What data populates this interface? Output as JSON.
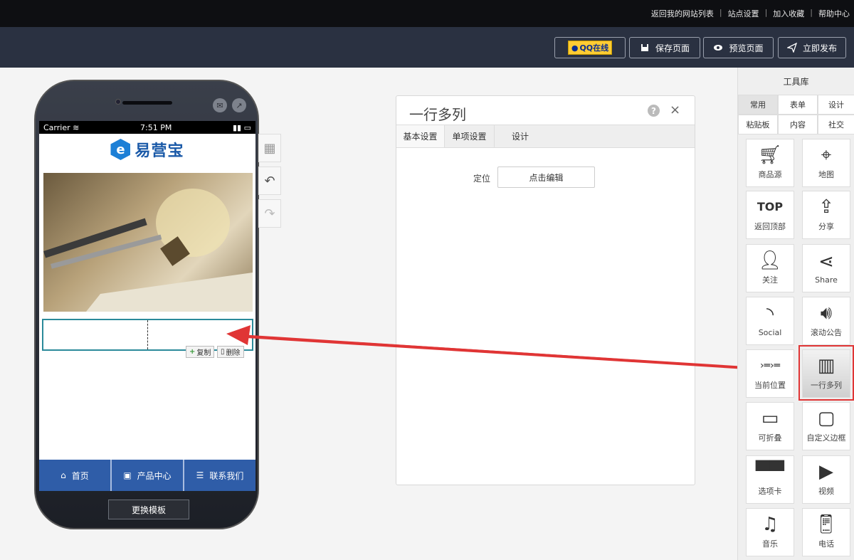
{
  "topbar": {
    "links": [
      "返回我的网站列表",
      "站点设置",
      "加入收藏",
      "帮助中心"
    ]
  },
  "toolbar": {
    "qq_label": "QQ在线",
    "save_label": "保存页面",
    "preview_label": "预览页面",
    "publish_label": "立即发布"
  },
  "phone": {
    "status": {
      "carrier": "Carrier",
      "time": "7:51 PM"
    },
    "logo_mark": "e",
    "logo_text": "易营宝",
    "copy_label": "复制",
    "delete_label": "删除",
    "nav": [
      {
        "label": "首页",
        "icon": "home-icon"
      },
      {
        "label": "产品中心",
        "icon": "image-icon"
      },
      {
        "label": "联系我们",
        "icon": "list-icon"
      }
    ],
    "template_btn": "更换模板"
  },
  "panel": {
    "title": "一行多列",
    "tabs": [
      "基本设置",
      "单项设置",
      "设计"
    ],
    "position_label": "定位",
    "edit_button": "点击编辑"
  },
  "toolbox": {
    "title": "工具库",
    "tabs": [
      "常用",
      "表单",
      "设计",
      "粘贴板",
      "内容",
      "社交"
    ],
    "active_tab": "常用",
    "tools": [
      {
        "label": "商品源",
        "icon": "cart-icon"
      },
      {
        "label": "地图",
        "icon": "map-icon"
      },
      {
        "label": "返回顶部",
        "icon": "top-icon"
      },
      {
        "label": "分享",
        "icon": "share-out-icon"
      },
      {
        "label": "关注",
        "icon": "follow-icon"
      },
      {
        "label": "Share",
        "icon": "share-icon"
      },
      {
        "label": "Social",
        "icon": "rss-icon"
      },
      {
        "label": "滚动公告",
        "icon": "speaker-icon"
      },
      {
        "label": "当前位置",
        "icon": "breadcrumb-icon"
      },
      {
        "label": "一行多列",
        "icon": "columns-icon"
      },
      {
        "label": "可折叠",
        "icon": "collapse-icon"
      },
      {
        "label": "自定义边框",
        "icon": "border-icon"
      },
      {
        "label": "选项卡",
        "icon": "tabs-icon"
      },
      {
        "label": "视频",
        "icon": "video-icon"
      },
      {
        "label": "音乐",
        "icon": "music-icon"
      },
      {
        "label": "电话",
        "icon": "phone-icon"
      }
    ]
  },
  "colors": {
    "topbar": "#0e0f12",
    "toolbar": "#2a3141",
    "nav_blue": "#2f5da8",
    "highlight_red": "#e03535"
  }
}
